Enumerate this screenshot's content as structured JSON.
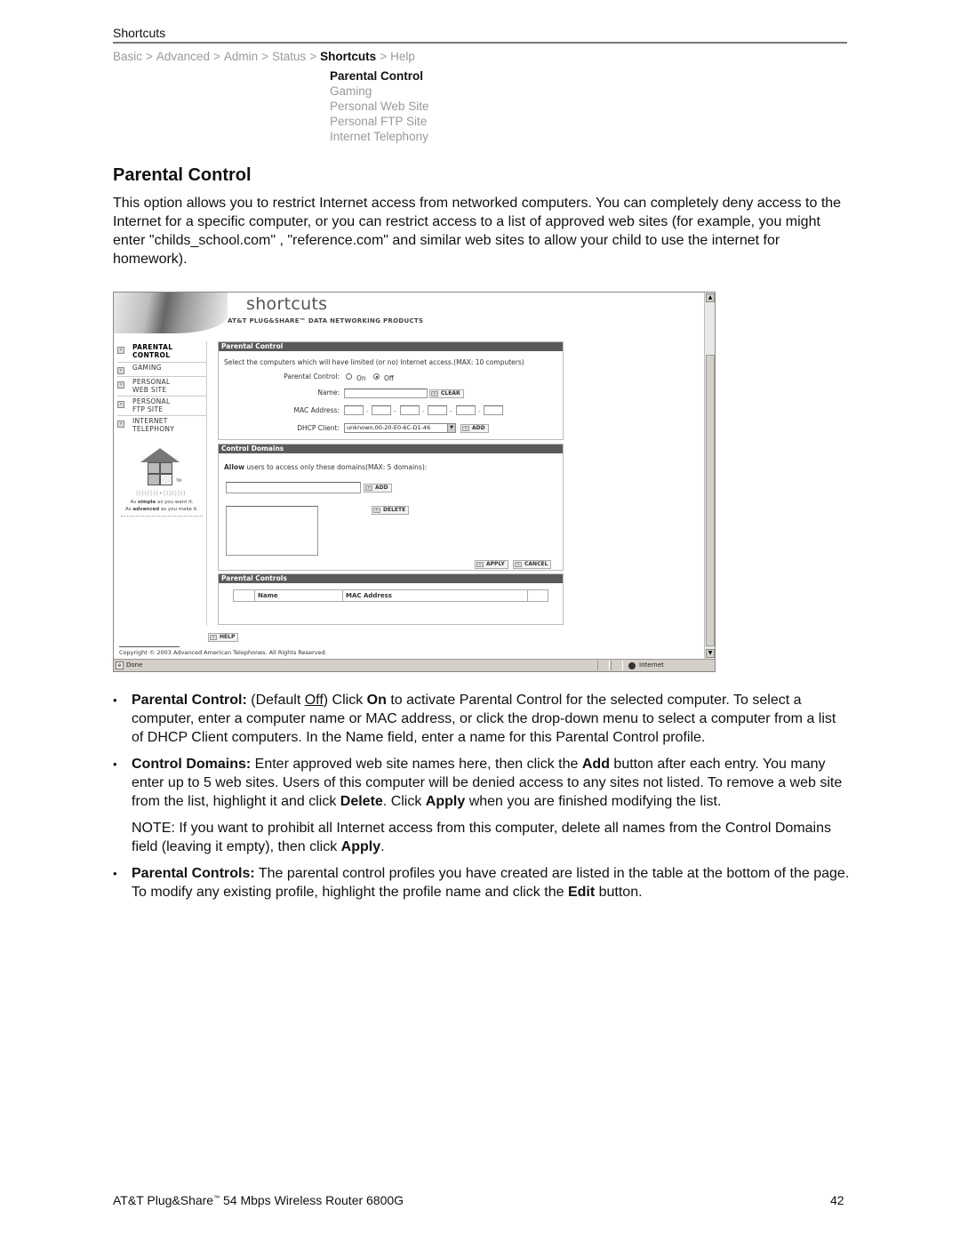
{
  "running_head": "Shortcuts",
  "breadcrumb": {
    "items": [
      "Basic",
      "Advanced",
      "Admin",
      "Status",
      "Shortcuts",
      "Help"
    ],
    "active_index": 4,
    "separator": ">"
  },
  "subnav": {
    "items": [
      "Parental Control",
      "Gaming",
      "Personal Web Site",
      "Personal FTP Site",
      "Internet Telephony"
    ],
    "active_index": 0
  },
  "section_title": "Parental Control",
  "intro": "This option allows you to restrict Internet access from networked computers. You can completely deny access to the Internet for a specific computer, or you can restrict access to a list of approved web sites (for example, you might enter \"childs_school.com\" , \"reference.com\" and similar web sites to allow your child to use the internet for homework).",
  "screenshot": {
    "banner_title": "shortcuts",
    "banner_subtitle": "AT&T PLUG&SHARE™ DATA NETWORKING PRODUCTS",
    "sidebar": [
      {
        "line1": "PARENTAL",
        "line2": "CONTROL",
        "active": true
      },
      {
        "line1": "GAMING",
        "line2": "",
        "active": false
      },
      {
        "line1": "PERSONAL",
        "line2": "WEB SITE",
        "active": false
      },
      {
        "line1": "PERSONAL",
        "line2": "FTP SITE",
        "active": false
      },
      {
        "line1": "INTERNET",
        "line2": "TELEPHONY",
        "active": false
      }
    ],
    "logo_tm": "TM",
    "waves": "((((((((•))))))))",
    "slogan_1_pre": "As ",
    "slogan_1_bold": "simple",
    "slogan_1_post": " as you want it.",
    "slogan_2_pre": "As ",
    "slogan_2_bold": "advanced",
    "slogan_2_post": " as you make it.",
    "parental_control": {
      "header": "Parental Control",
      "instruction": "Select the computers which will have limited (or no) Internet access.(MAX: 10 computers)",
      "pc_label": "Parental Control:",
      "on_label": "On",
      "off_label": "Off",
      "selected": "Off",
      "name_label": "Name:",
      "name_value": "",
      "clear_label": "CLEAR",
      "mac_label": "MAC Address:",
      "mac_values": [
        "",
        "",
        "",
        "",
        "",
        ""
      ],
      "mac_sep": "-",
      "dhcp_label": "DHCP Client:",
      "dhcp_selected": "unknown,00-20-E0-6C-D1-46",
      "add_label": "ADD"
    },
    "control_domains": {
      "header": "Control Domains",
      "instruction_bold": "Allow",
      "instruction_rest": " users to access only these domains(MAX: 5 domains):",
      "domain_value": "",
      "add_label": "ADD",
      "delete_label": "DELETE",
      "apply_label": "APPLY",
      "cancel_label": "CANCEL"
    },
    "parental_controls_table": {
      "header": "Parental Controls",
      "columns": [
        "",
        "Name",
        "MAC Address",
        ""
      ]
    },
    "help_label": "HELP",
    "copyright": "Copyright © 2003 Advanced American Telephones. All Rights Reserved.",
    "status_text": "Done",
    "zone_text": "Internet"
  },
  "bullets": {
    "b1_title": "Parental Control:",
    "b1_pre": " (Default ",
    "b1_default": "Off",
    "b1_mid": ") Click ",
    "b1_on": "On",
    "b1_rest": " to activate Parental Control for the selected computer. To select a computer, enter a computer name or MAC address, or click the drop-down menu to select a computer from a list of DHCP Client computers. In the Name field, enter a name for this Parental Control profile.",
    "b2_title": "Control Domains:",
    "b2_a": " Enter approved web site names here, then click the ",
    "b2_add": "Add",
    "b2_b": " button after each entry. You many enter up to 5 web sites. Users of this computer will be denied access to any sites not listed. To remove a web site from the list, highlight it and click ",
    "b2_delete": "Delete",
    "b2_c": ". Click ",
    "b2_apply": "Apply",
    "b2_d": " when you are finished modifying the list.",
    "note_a": "NOTE: If you want to prohibit all Internet access from this computer, delete all names from the Control Domains field (leaving it empty), then click ",
    "note_apply": "Apply",
    "note_b": ".",
    "b3_title": "Parental Controls:",
    "b3_a": " The parental control profiles you have created are listed in the table at the bottom of the page. To modify any existing profile, highlight the profile name and click the ",
    "b3_edit": "Edit",
    "b3_b": " button."
  },
  "footer": {
    "product_pre": "AT&T Plug&Share",
    "product_tm": "™",
    "product_post": " 54 Mbps Wireless Router 6800G",
    "page_number": "42"
  }
}
